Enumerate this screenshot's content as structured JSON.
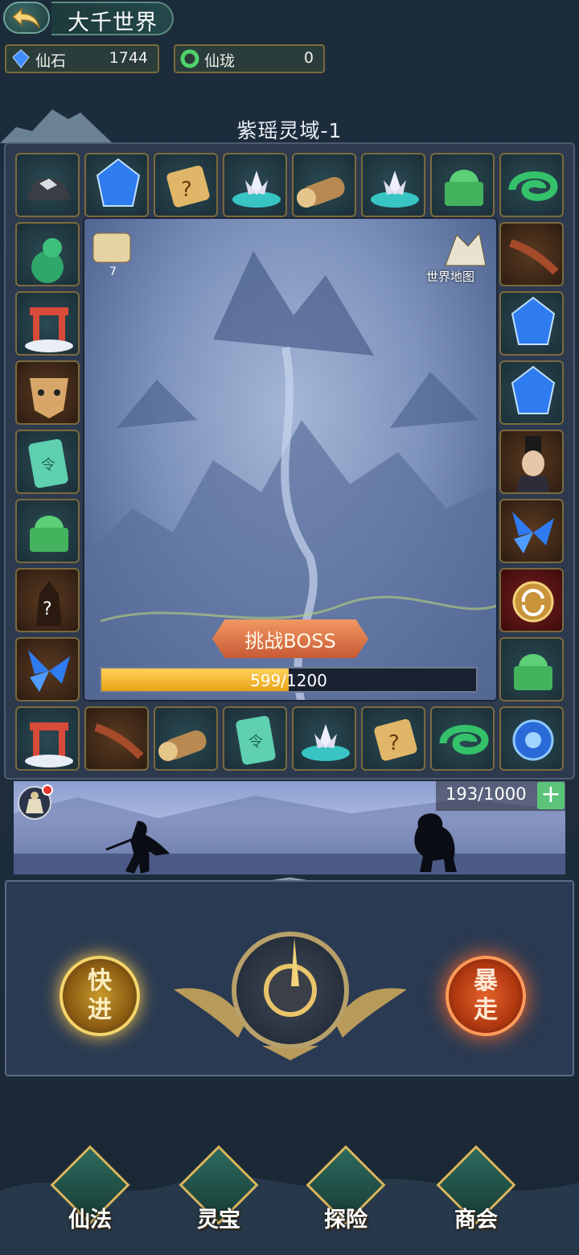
{
  "header": {
    "title": "大千世界"
  },
  "resources": [
    {
      "label": "仙石",
      "value": "1744",
      "icon": "blue-gem-icon"
    },
    {
      "label": "仙珑",
      "value": "0",
      "icon": "green-jade-ring-icon"
    }
  ],
  "region": {
    "title": "紫瑶灵域-1"
  },
  "map": {
    "scroll_count": "7",
    "world_map_label": "世界地图"
  },
  "boss": {
    "label": "挑战BOSS",
    "progress_text": "599/1200",
    "progress_fraction": 0.4992
  },
  "battle": {
    "energy_text": "193/1000",
    "plus_label": "+"
  },
  "controls": {
    "speed_label": "快进",
    "rage_label": "暴走"
  },
  "board_tiles": [
    "ore-icon",
    "blue-crystal-icon",
    "mystery-scroll-icon",
    "lotus-icon",
    "wood-log-icon",
    "lotus-icon",
    "jade-dragon-seal-icon",
    "jade-ring-icon",
    "gourd-icon",
    "centipede-icon",
    "gate-icon",
    "blue-crystal-icon",
    "tiger-mask-icon",
    "blue-crystal-icon",
    "jade-token-icon",
    "sorcerer-portrait-icon",
    "jade-dragon-seal-icon",
    "blue-butterfly-icon",
    "mystery-figure-icon",
    "refresh-icon",
    "blue-butterfly-icon",
    "jade-dragon-seal-icon",
    "gate-icon",
    "centipede-icon",
    "wood-log-icon",
    "jade-token-icon",
    "lotus-icon",
    "mystery-scroll-icon",
    "jade-ring-icon",
    "blue-orb-icon"
  ],
  "nav": [
    {
      "label": "仙法",
      "icon": "sword-icon"
    },
    {
      "label": "灵宝",
      "icon": "lotus-treasure-icon"
    },
    {
      "label": "探险",
      "icon": "adventure-icon"
    },
    {
      "label": "商会",
      "icon": "shop-icon"
    }
  ],
  "colors": {
    "accent_gold": "#d8b55c",
    "progress": "#f2b632",
    "plus": "#5cc47a"
  }
}
